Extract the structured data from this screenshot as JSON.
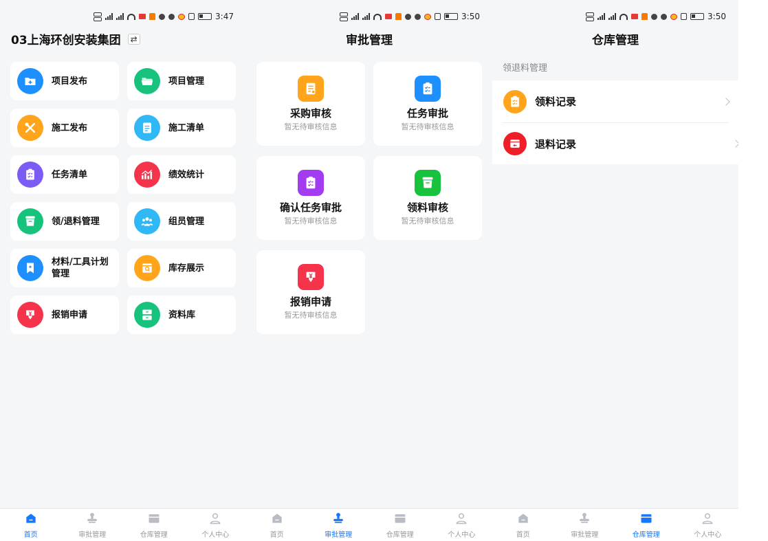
{
  "screens": [
    {
      "status": {
        "time": "3:47"
      },
      "header": {
        "title": "03上海环创安装集团",
        "switch_icon": "swap-icon"
      },
      "items": [
        {
          "label": "项目发布",
          "icon": "folder-add-icon",
          "color": "#1e8fff"
        },
        {
          "label": "项目管理",
          "icon": "folder-open-icon",
          "color": "#17c27c"
        },
        {
          "label": "施工发布",
          "icon": "tools-icon",
          "color": "#ffa41b"
        },
        {
          "label": "施工清单",
          "icon": "document-icon",
          "color": "#2fb8f5"
        },
        {
          "label": "任务清单",
          "icon": "checklist-icon",
          "color": "#7b5cf5"
        },
        {
          "label": "绩效统计",
          "icon": "chart-icon",
          "color": "#f5334b"
        },
        {
          "label": "领/退料管理",
          "icon": "basket-icon",
          "color": "#17c27c"
        },
        {
          "label": "组员管理",
          "icon": "team-icon",
          "color": "#2fb8f5"
        },
        {
          "label": "材料/工具计划管理",
          "icon": "bookmark-icon",
          "color": "#1e8fff"
        },
        {
          "label": "库存展示",
          "icon": "box-search-icon",
          "color": "#ffa41b"
        },
        {
          "label": "报销申请",
          "icon": "yuan-down-icon",
          "color": "#f5334b"
        },
        {
          "label": "资料库",
          "icon": "cabinet-icon",
          "color": "#17c27c"
        }
      ],
      "active_tab": 0
    },
    {
      "status": {
        "time": "3:50"
      },
      "header": {
        "title": "审批管理"
      },
      "cards": [
        {
          "label": "采购审核",
          "sub": "暂无待审核信息",
          "icon": "purchase-icon",
          "color": "#ffa41b"
        },
        {
          "label": "任务审批",
          "sub": "暂无待审核信息",
          "icon": "clipboard-check-icon",
          "color": "#1e8fff"
        },
        {
          "label": "确认任务审批",
          "sub": "暂无待审核信息",
          "icon": "clipboard-confirm-icon",
          "color": "#a33cf0"
        },
        {
          "label": "领料审核",
          "sub": "暂无待审核信息",
          "icon": "basket-icon",
          "color": "#17c23c"
        },
        {
          "label": "报销申请",
          "sub": "暂无待审核信息",
          "icon": "yuan-down-icon",
          "color": "#f5334b"
        }
      ],
      "active_tab": 1
    },
    {
      "status": {
        "time": "3:50"
      },
      "header": {
        "title": "仓库管理"
      },
      "section": "领退料管理",
      "rows": [
        {
          "label": "领料记录",
          "icon": "checklist-icon",
          "color": "#ffa41b"
        },
        {
          "label": "退料记录",
          "icon": "return-icon",
          "color": "#ef1f2a"
        }
      ],
      "active_tab": 2
    }
  ],
  "tabs": [
    {
      "label": "首页",
      "icon": "home-icon"
    },
    {
      "label": "审批管理",
      "icon": "stamp-icon"
    },
    {
      "label": "仓库管理",
      "icon": "warehouse-icon"
    },
    {
      "label": "个人中心",
      "icon": "user-icon"
    }
  ],
  "colors": {
    "active": "#1677ff",
    "inactive": "#b8bcc4"
  }
}
